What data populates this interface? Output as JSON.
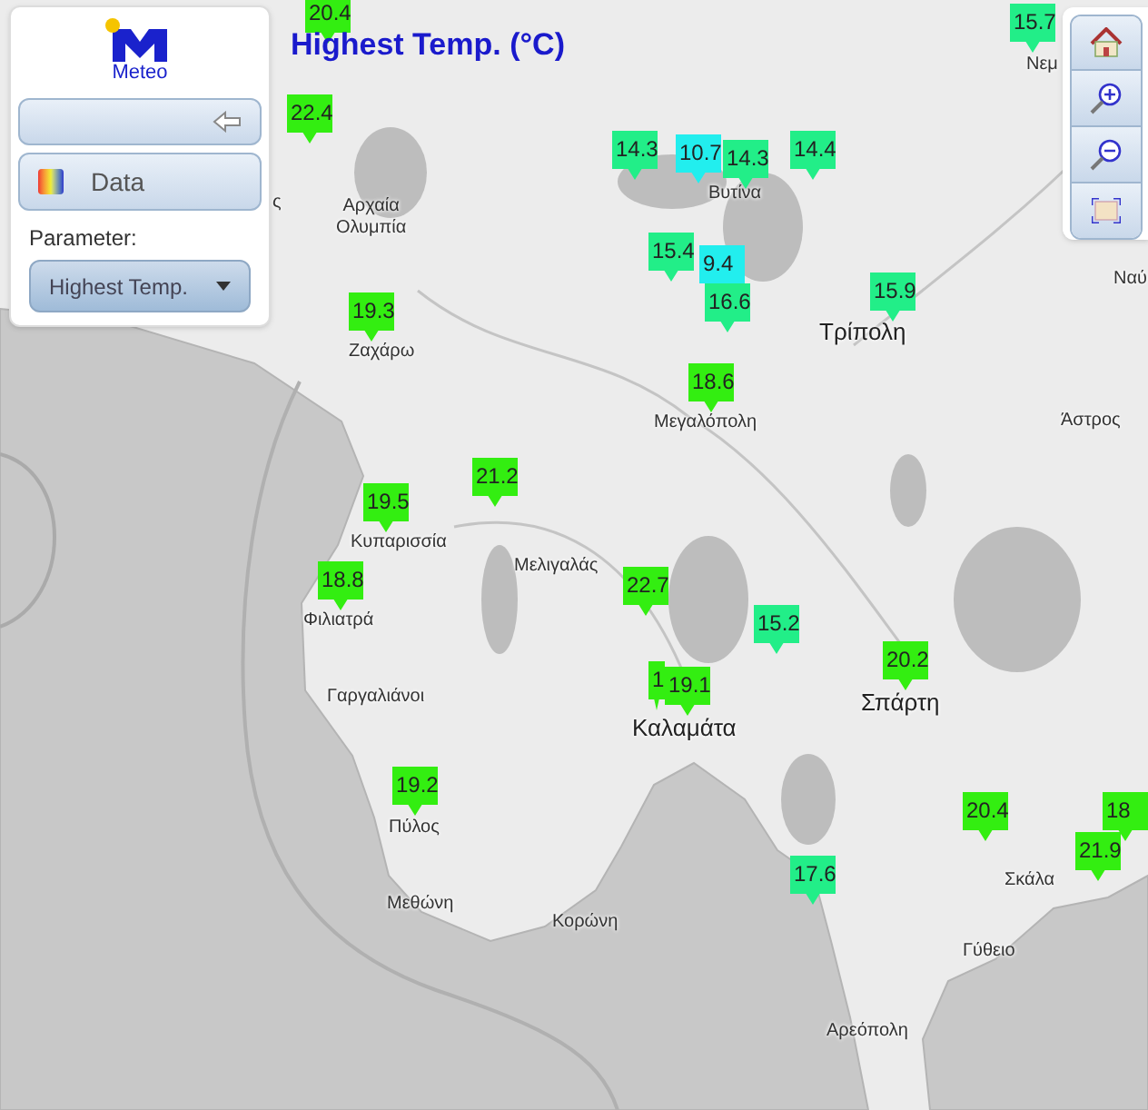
{
  "title": "Highest Temp. (°C)",
  "panel": {
    "logo_text": "Meteo",
    "data_button": "Data",
    "parameter_label": "Parameter:",
    "parameter_select": "Highest Temp."
  },
  "markers": [
    {
      "value": "20.4",
      "color": "#33ee11"
    },
    {
      "value": "22.4",
      "color": "#33ee11"
    },
    {
      "value": "14.3",
      "color": "#22ee88"
    },
    {
      "value": "10.7",
      "color": "#22eeee"
    },
    {
      "value": "14.3",
      "color": "#22ee88"
    },
    {
      "value": "14.4",
      "color": "#22ee88"
    },
    {
      "value": "15.7",
      "color": "#22ee88"
    },
    {
      "value": "15.4",
      "color": "#22ee88"
    },
    {
      "value": "9.4",
      "color": "#22eeee"
    },
    {
      "value": "16.6",
      "color": "#22ee88"
    },
    {
      "value": "15.9",
      "color": "#22ee88"
    },
    {
      "value": "19.3",
      "color": "#33ee11"
    },
    {
      "value": "18.6",
      "color": "#33ee11"
    },
    {
      "value": "21.2",
      "color": "#33ee11"
    },
    {
      "value": "19.5",
      "color": "#33ee11"
    },
    {
      "value": "18.8",
      "color": "#33ee11"
    },
    {
      "value": "22.7",
      "color": "#33ee11"
    },
    {
      "value": "15.2",
      "color": "#22ee88"
    },
    {
      "value": "20.2",
      "color": "#33ee11"
    },
    {
      "value": "1",
      "color": "#33ee11"
    },
    {
      "value": "19.1",
      "color": "#33ee11"
    },
    {
      "value": "19.2",
      "color": "#33ee11"
    },
    {
      "value": "17.6",
      "color": "#22ee88"
    },
    {
      "value": "20.4",
      "color": "#33ee11"
    },
    {
      "value": "21.9",
      "color": "#33ee11"
    },
    {
      "value": "18",
      "color": "#33ee11"
    }
  ],
  "places": [
    {
      "name": "ς",
      "major": false
    },
    {
      "name": "Αρχαία\nΟλυμπία",
      "major": false
    },
    {
      "name": "Νεμ",
      "major": false
    },
    {
      "name": "Ζαχάρω",
      "major": false
    },
    {
      "name": "Βυτίνα",
      "major": false
    },
    {
      "name": "Τρίπολη",
      "major": true
    },
    {
      "name": "Ναύ",
      "major": false
    },
    {
      "name": "Μεγαλόπολη",
      "major": false
    },
    {
      "name": "Άστρος",
      "major": false
    },
    {
      "name": "Κυπαρισσία",
      "major": false
    },
    {
      "name": "Μελιγαλάς",
      "major": false
    },
    {
      "name": "Φιλιατρά",
      "major": false
    },
    {
      "name": "Γαργαλιάνοι",
      "major": false
    },
    {
      "name": "Καλαμάτα",
      "major": true
    },
    {
      "name": "Σπάρτη",
      "major": true
    },
    {
      "name": "Πύλος",
      "major": false
    },
    {
      "name": "Μεθώνη",
      "major": false
    },
    {
      "name": "Κορώνη",
      "major": false
    },
    {
      "name": "Σκάλα",
      "major": false
    },
    {
      "name": "Γύθειο",
      "major": false
    },
    {
      "name": "Αρεόπολη",
      "major": false
    }
  ]
}
